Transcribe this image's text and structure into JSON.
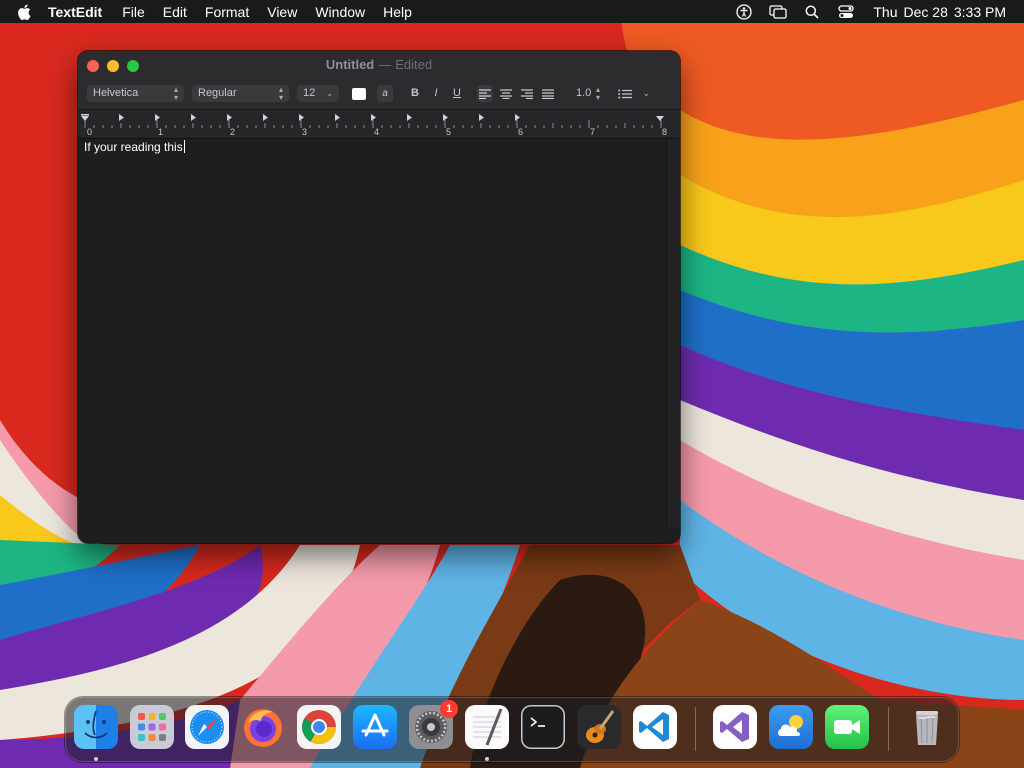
{
  "menubar": {
    "app_name": "TextEdit",
    "menus": [
      "File",
      "Edit",
      "Format",
      "View",
      "Window",
      "Help"
    ],
    "clock": {
      "day": "Thu",
      "date": "Dec 28",
      "time": "3:33 PM"
    }
  },
  "window": {
    "title": "Untitled",
    "separator": "—",
    "status": "Edited",
    "toolbar": {
      "font_family": "Helvetica",
      "font_style": "Regular",
      "font_size": "12",
      "highlight_label": "a",
      "bold_label": "B",
      "italic_label": "I",
      "underline_label": "U",
      "line_spacing": "1.0"
    },
    "ruler": {
      "labels": [
        "0",
        "1",
        "2",
        "3",
        "4",
        "5",
        "6",
        "7",
        "8"
      ]
    },
    "document": {
      "text": "If your reading this"
    }
  },
  "dock": {
    "settings_badge": "1"
  },
  "colors": {
    "menubar_bg": "#1a1a1c",
    "window_bg": "#1e1e1e",
    "toolbar_bg": "#2c2c2e",
    "close": "#fe5f57",
    "minimize": "#febc2e",
    "maximize": "#28c840",
    "badge": "#ff3b30"
  },
  "icons": {
    "menubar_right": [
      "accessibility-icon",
      "screen-mirroring-icon",
      "search-icon",
      "control-center-icon"
    ],
    "dock": [
      "finder-icon",
      "launchpad-icon",
      "safari-icon",
      "firefox-icon",
      "chrome-icon",
      "app-store-icon",
      "system-settings-icon",
      "textedit-icon",
      "terminal-icon",
      "garageband-icon",
      "vscode-icon",
      "visual-studio-icon",
      "weather-icon",
      "facetime-icon",
      "trash-icon"
    ]
  }
}
